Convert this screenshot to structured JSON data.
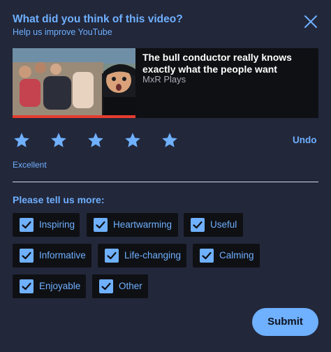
{
  "header": {
    "title": "What did you think of this video?",
    "subtitle": "Help us improve YouTube",
    "close_icon": "close-icon"
  },
  "video": {
    "title": "The bull conductor really knows exactly what the people want",
    "channel": "MxR Plays",
    "progress_fraction": 1.0,
    "progress_color": "#e63c2f"
  },
  "rating": {
    "stars_filled": 5,
    "stars_total": 5,
    "label": "Excellent",
    "undo_label": "Undo",
    "star_icon": "star-icon"
  },
  "feedback": {
    "prompt": "Please tell us more:",
    "options": [
      {
        "label": "Inspiring",
        "checked": true
      },
      {
        "label": "Heartwarming",
        "checked": true
      },
      {
        "label": "Useful",
        "checked": true
      },
      {
        "label": "Informative",
        "checked": true
      },
      {
        "label": "Life-changing",
        "checked": true
      },
      {
        "label": "Calming",
        "checked": true
      },
      {
        "label": "Enjoyable",
        "checked": true
      },
      {
        "label": "Other",
        "checked": true
      }
    ]
  },
  "submit_label": "Submit",
  "colors": {
    "accent": "#6fb0ff",
    "panel_bg": "#22273a",
    "chip_bg": "#0f1014"
  }
}
